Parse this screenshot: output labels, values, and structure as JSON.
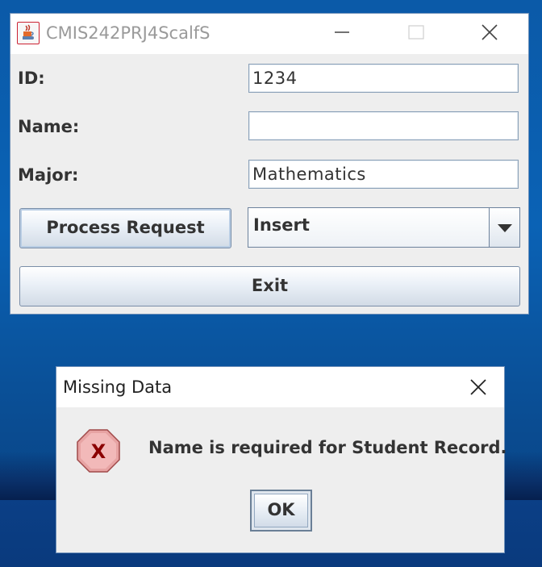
{
  "main_window": {
    "title": "CMIS242PRJ4ScalfS",
    "fields": [
      {
        "label": "ID:",
        "value": "1234"
      },
      {
        "label": "Name:",
        "value": ""
      },
      {
        "label": "Major:",
        "value": "Mathematics"
      }
    ],
    "process_button_label": "Process Request",
    "action_combo_value": "Insert",
    "exit_button_label": "Exit"
  },
  "dialog": {
    "title": "Missing Data",
    "message": "Name is required for Student Record.",
    "ok_label": "OK",
    "icon": "error-icon"
  },
  "colors": {
    "desktop_blue": "#0a62b5",
    "window_bg": "#eeeeee",
    "error_red": "#c0392b"
  }
}
